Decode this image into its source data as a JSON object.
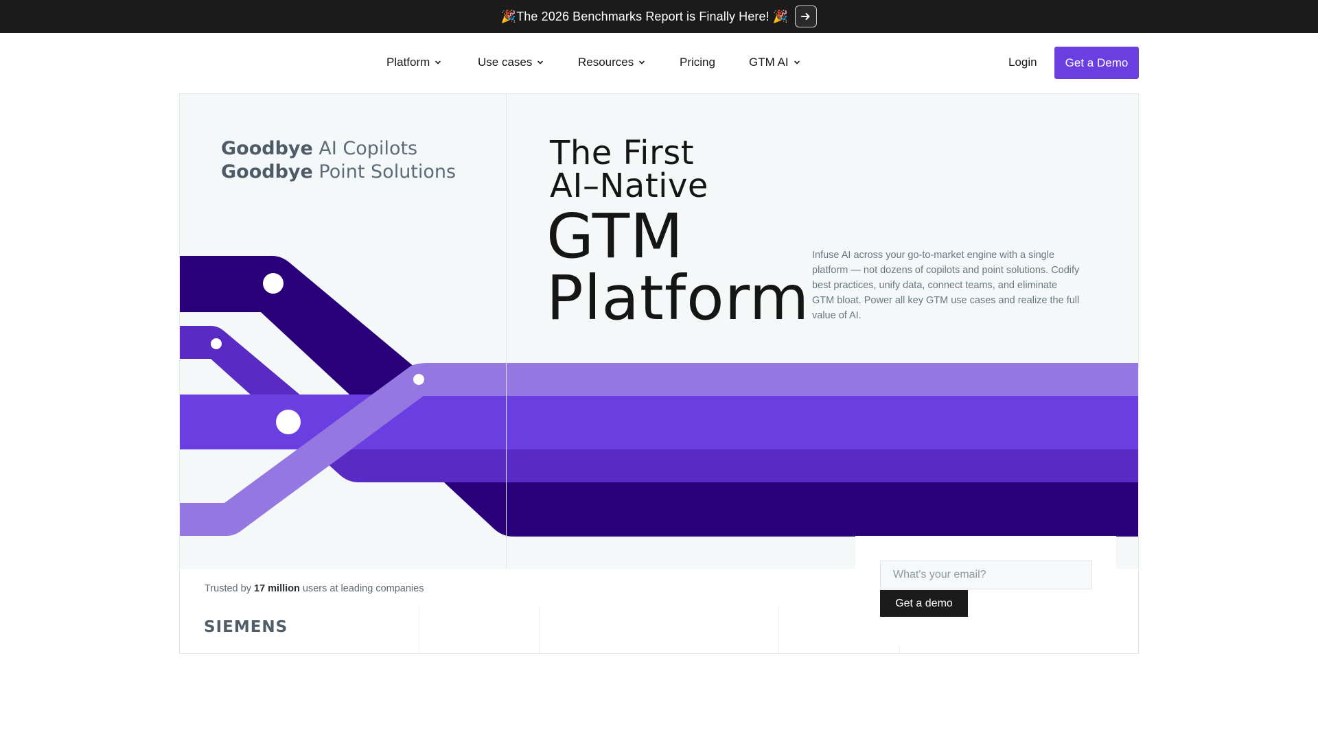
{
  "announcement": {
    "text": "🎉The 2026 Benchmarks Report is Finally Here! 🎉",
    "arrow_icon": "arrow-right-icon"
  },
  "nav": {
    "items": [
      {
        "label": "Platform",
        "has_dropdown": true
      },
      {
        "label": "Use cases",
        "has_dropdown": true
      },
      {
        "label": "Resources",
        "has_dropdown": true
      },
      {
        "label": "Pricing",
        "has_dropdown": false
      },
      {
        "label": "GTM AI",
        "has_dropdown": true
      }
    ],
    "login": "Login",
    "cta": "Get a Demo"
  },
  "hero": {
    "goodbye_1_bold": "Goodbye",
    "goodbye_1_rest": " AI Copilots",
    "goodbye_2_bold": "Goodbye",
    "goodbye_2_rest": " Point Solutions",
    "headline_line1": "The First",
    "headline_line2": "AI–Native",
    "headline_line3": "GTM",
    "headline_line4": "Platform",
    "description": "Infuse AI across your go-to-market engine with a single platform — not dozens of copilots and point solutions. Codify best practices, unify data, connect teams, and eliminate GTM bloat. Power all key GTM use cases and realize the full value of AI."
  },
  "trusted": {
    "prefix": "Trusted by ",
    "count": "17 million",
    "suffix": " users at leading companies",
    "logos": [
      "SIEMENS"
    ]
  },
  "signup": {
    "placeholder": "What's your email?",
    "button": "Get a demo"
  },
  "colors": {
    "accent": "#6a3ee0",
    "purple_dark": "#2a007a",
    "purple_mid": "#5a2bc4",
    "purple_light": "#9477e0",
    "announcement_bg": "#1b1b1b",
    "hero_bg": "#f4f8f9"
  }
}
